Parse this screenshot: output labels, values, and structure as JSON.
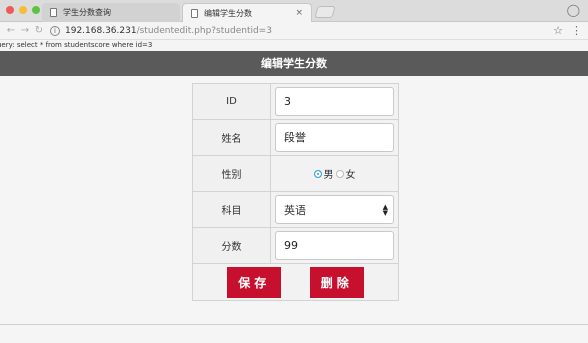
{
  "tabs": [
    {
      "label": "学生分数查询"
    },
    {
      "label": "编辑学生分数",
      "close": "×"
    }
  ],
  "address": {
    "host": "192.168.36.231",
    "path": "/studentedit.php?studentid=3"
  },
  "query_text": "uery: select * from studentscore where id=3",
  "page_title": "编辑学生分数",
  "form": {
    "id_label": "ID",
    "id_value": "3",
    "name_label": "姓名",
    "name_value": "段誉",
    "gender_label": "性别",
    "gender_male": "男",
    "gender_female": "女",
    "subject_label": "科目",
    "subject_value": "英语",
    "score_label": "分数",
    "score_value": "99",
    "save_label": "保存",
    "delete_label": "删除"
  },
  "colors": {
    "header_bg": "#5a5a5a",
    "button_bg": "#c6102e",
    "radio_selected": "#2e9fe0"
  }
}
